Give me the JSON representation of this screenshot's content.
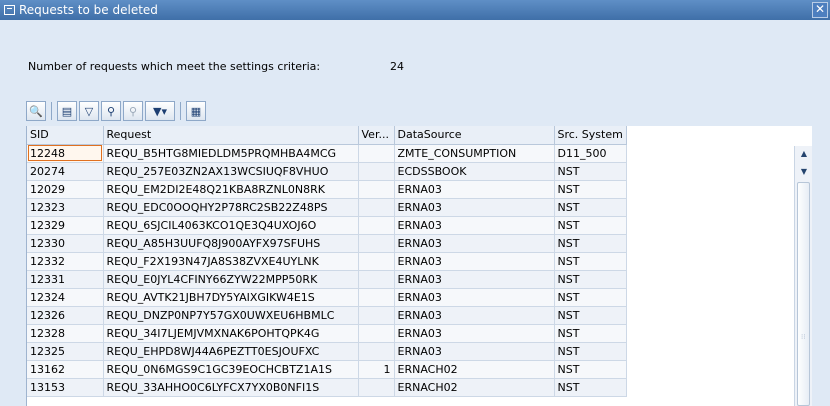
{
  "window": {
    "title": "Requests to be deleted",
    "close_glyph": "✕"
  },
  "criteria": {
    "label": "Number of requests which meet the settings criteria:",
    "value": "24"
  },
  "toolbar": {
    "icons": [
      "details-icon",
      "print-icon",
      "filter-icon",
      "find-icon",
      "find-next-icon",
      "set-filter-icon",
      "layout-icon"
    ]
  },
  "table": {
    "columns": [
      "SID",
      "Request",
      "Ver...",
      "DataSource",
      "Src. System"
    ],
    "rows": [
      [
        "12248",
        "REQU_B5HTG8MIEDLDM5PRQMHBA4MCG",
        "",
        "ZMTE_CONSUMPTION",
        "D11_500"
      ],
      [
        "20274",
        "REQU_257E03ZN2AX13WCSIUQF8VHUO",
        "",
        "ECDSSBOOK",
        "NST"
      ],
      [
        "12029",
        "REQU_EM2DI2E48Q21KBA8RZNL0N8RK",
        "",
        "ERNA03",
        "NST"
      ],
      [
        "12323",
        "REQU_EDC0OOQHY2P78RC2SB22Z48PS",
        "",
        "ERNA03",
        "NST"
      ],
      [
        "12329",
        "REQU_6SJCIL4063KCO1QE3Q4UXOJ6O",
        "",
        "ERNA03",
        "NST"
      ],
      [
        "12330",
        "REQU_A85H3UUFQ8J900AYFX97SFUHS",
        "",
        "ERNA03",
        "NST"
      ],
      [
        "12332",
        "REQU_F2X193N47JA8S38ZVXE4UYLNK",
        "",
        "ERNA03",
        "NST"
      ],
      [
        "12331",
        "REQU_E0JYL4CFINY66ZYW22MPP50RK",
        "",
        "ERNA03",
        "NST"
      ],
      [
        "12324",
        "REQU_AVTK21JBH7DY5YAIXGIKW4E1S",
        "",
        "ERNA03",
        "NST"
      ],
      [
        "12326",
        "REQU_DNZP0NP7Y57GX0UWXEU6HBMLC",
        "",
        "ERNA03",
        "NST"
      ],
      [
        "12328",
        "REQU_34I7LJEMJVMXNAK6POHTQPK4G",
        "",
        "ERNA03",
        "NST"
      ],
      [
        "12325",
        "REQU_EHPD8WJ44A6PEZTT0ESJOUFXC",
        "",
        "ERNA03",
        "NST"
      ],
      [
        "13162",
        "REQU_0N6MGS9C1GC39EOCHCBTZ1A1S",
        "1",
        "ERNACH02",
        "NST"
      ],
      [
        "13153",
        "REQU_33AHHO0C6LYFCX7YX0B0NFI1S",
        "",
        "ERNACH02",
        "NST"
      ]
    ]
  },
  "scrollbar": {
    "up_glyph": "▲",
    "down_glyph": "▼",
    "grip_glyph": "⁞⁞"
  }
}
